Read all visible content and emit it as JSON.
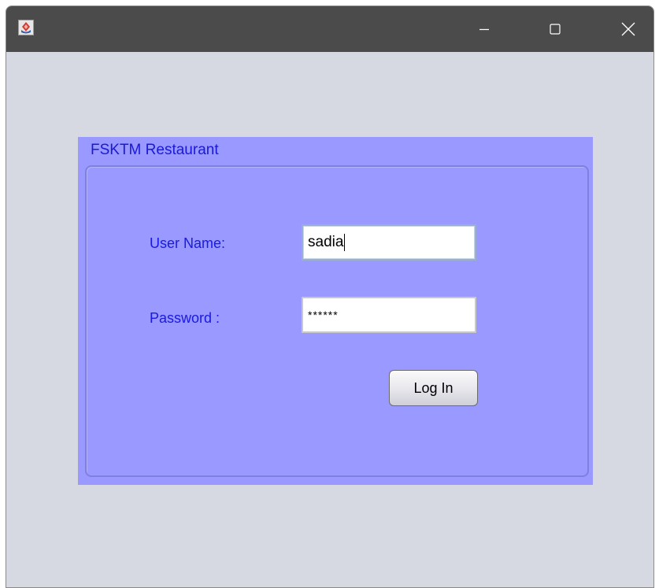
{
  "window": {
    "app_icon": "java-cup-icon",
    "controls": {
      "minimize_icon": "minimize-icon",
      "maximize_icon": "maximize-icon",
      "close_icon": "close-icon"
    }
  },
  "panel": {
    "title": "FSKTM Restaurant",
    "background_color": "#9999ff",
    "label_color": "#1a1ae0"
  },
  "form": {
    "username_label": "User Name:",
    "username_value": "sadia",
    "password_label": "Password :",
    "password_display": "******",
    "login_label": "Log In"
  }
}
